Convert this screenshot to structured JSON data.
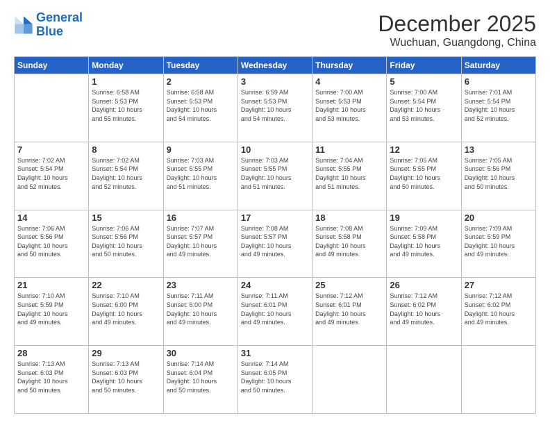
{
  "logo": {
    "line1": "General",
    "line2": "Blue"
  },
  "title": "December 2025",
  "subtitle": "Wuchuan, Guangdong, China",
  "header_days": [
    "Sunday",
    "Monday",
    "Tuesday",
    "Wednesday",
    "Thursday",
    "Friday",
    "Saturday"
  ],
  "weeks": [
    [
      {
        "day": "",
        "info": ""
      },
      {
        "day": "1",
        "info": "Sunrise: 6:58 AM\nSunset: 5:53 PM\nDaylight: 10 hours\nand 55 minutes."
      },
      {
        "day": "2",
        "info": "Sunrise: 6:58 AM\nSunset: 5:53 PM\nDaylight: 10 hours\nand 54 minutes."
      },
      {
        "day": "3",
        "info": "Sunrise: 6:59 AM\nSunset: 5:53 PM\nDaylight: 10 hours\nand 54 minutes."
      },
      {
        "day": "4",
        "info": "Sunrise: 7:00 AM\nSunset: 5:53 PM\nDaylight: 10 hours\nand 53 minutes."
      },
      {
        "day": "5",
        "info": "Sunrise: 7:00 AM\nSunset: 5:54 PM\nDaylight: 10 hours\nand 53 minutes."
      },
      {
        "day": "6",
        "info": "Sunrise: 7:01 AM\nSunset: 5:54 PM\nDaylight: 10 hours\nand 52 minutes."
      }
    ],
    [
      {
        "day": "7",
        "info": "Sunrise: 7:02 AM\nSunset: 5:54 PM\nDaylight: 10 hours\nand 52 minutes."
      },
      {
        "day": "8",
        "info": "Sunrise: 7:02 AM\nSunset: 5:54 PM\nDaylight: 10 hours\nand 52 minutes."
      },
      {
        "day": "9",
        "info": "Sunrise: 7:03 AM\nSunset: 5:55 PM\nDaylight: 10 hours\nand 51 minutes."
      },
      {
        "day": "10",
        "info": "Sunrise: 7:03 AM\nSunset: 5:55 PM\nDaylight: 10 hours\nand 51 minutes."
      },
      {
        "day": "11",
        "info": "Sunrise: 7:04 AM\nSunset: 5:55 PM\nDaylight: 10 hours\nand 51 minutes."
      },
      {
        "day": "12",
        "info": "Sunrise: 7:05 AM\nSunset: 5:55 PM\nDaylight: 10 hours\nand 50 minutes."
      },
      {
        "day": "13",
        "info": "Sunrise: 7:05 AM\nSunset: 5:56 PM\nDaylight: 10 hours\nand 50 minutes."
      }
    ],
    [
      {
        "day": "14",
        "info": "Sunrise: 7:06 AM\nSunset: 5:56 PM\nDaylight: 10 hours\nand 50 minutes."
      },
      {
        "day": "15",
        "info": "Sunrise: 7:06 AM\nSunset: 5:56 PM\nDaylight: 10 hours\nand 50 minutes."
      },
      {
        "day": "16",
        "info": "Sunrise: 7:07 AM\nSunset: 5:57 PM\nDaylight: 10 hours\nand 49 minutes."
      },
      {
        "day": "17",
        "info": "Sunrise: 7:08 AM\nSunset: 5:57 PM\nDaylight: 10 hours\nand 49 minutes."
      },
      {
        "day": "18",
        "info": "Sunrise: 7:08 AM\nSunset: 5:58 PM\nDaylight: 10 hours\nand 49 minutes."
      },
      {
        "day": "19",
        "info": "Sunrise: 7:09 AM\nSunset: 5:58 PM\nDaylight: 10 hours\nand 49 minutes."
      },
      {
        "day": "20",
        "info": "Sunrise: 7:09 AM\nSunset: 5:59 PM\nDaylight: 10 hours\nand 49 minutes."
      }
    ],
    [
      {
        "day": "21",
        "info": "Sunrise: 7:10 AM\nSunset: 5:59 PM\nDaylight: 10 hours\nand 49 minutes."
      },
      {
        "day": "22",
        "info": "Sunrise: 7:10 AM\nSunset: 6:00 PM\nDaylight: 10 hours\nand 49 minutes."
      },
      {
        "day": "23",
        "info": "Sunrise: 7:11 AM\nSunset: 6:00 PM\nDaylight: 10 hours\nand 49 minutes."
      },
      {
        "day": "24",
        "info": "Sunrise: 7:11 AM\nSunset: 6:01 PM\nDaylight: 10 hours\nand 49 minutes."
      },
      {
        "day": "25",
        "info": "Sunrise: 7:12 AM\nSunset: 6:01 PM\nDaylight: 10 hours\nand 49 minutes."
      },
      {
        "day": "26",
        "info": "Sunrise: 7:12 AM\nSunset: 6:02 PM\nDaylight: 10 hours\nand 49 minutes."
      },
      {
        "day": "27",
        "info": "Sunrise: 7:12 AM\nSunset: 6:02 PM\nDaylight: 10 hours\nand 49 minutes."
      }
    ],
    [
      {
        "day": "28",
        "info": "Sunrise: 7:13 AM\nSunset: 6:03 PM\nDaylight: 10 hours\nand 50 minutes."
      },
      {
        "day": "29",
        "info": "Sunrise: 7:13 AM\nSunset: 6:03 PM\nDaylight: 10 hours\nand 50 minutes."
      },
      {
        "day": "30",
        "info": "Sunrise: 7:14 AM\nSunset: 6:04 PM\nDaylight: 10 hours\nand 50 minutes."
      },
      {
        "day": "31",
        "info": "Sunrise: 7:14 AM\nSunset: 6:05 PM\nDaylight: 10 hours\nand 50 minutes."
      },
      {
        "day": "",
        "info": ""
      },
      {
        "day": "",
        "info": ""
      },
      {
        "day": "",
        "info": ""
      }
    ]
  ]
}
